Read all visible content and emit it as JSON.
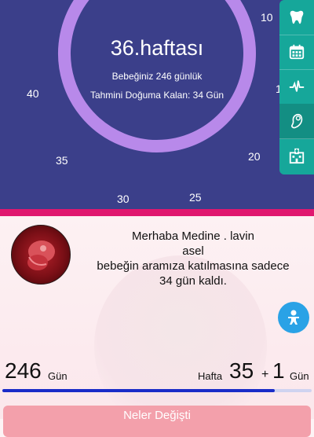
{
  "header": {
    "week_title": "36.haftası",
    "baby_age_text": "Bebeğiniz 246 günlük",
    "due_remaining_text": "Tahmini Doğuma Kalan: 34 Gün",
    "ticks": [
      "10",
      "1",
      "20",
      "25",
      "30",
      "35",
      "40"
    ],
    "ring_progress_fraction": 0.9,
    "colors": {
      "background": "#3b3f8a",
      "ring": "#b889ea",
      "ring_track": "#4d5199"
    }
  },
  "side_rail": {
    "items": [
      {
        "icon": "tooth-icon"
      },
      {
        "icon": "calendar-icon"
      },
      {
        "icon": "heartbeat-icon"
      },
      {
        "icon": "fetus-icon",
        "active": true
      },
      {
        "icon": "hospital-icon"
      }
    ],
    "color": "#16a79a"
  },
  "greeting": {
    "line1": "Merhaba Medine . lavin",
    "line2": "asel",
    "line3": "bebeğin aramıza katılmasına sadece",
    "line4": "34 gün kaldı."
  },
  "stats": {
    "days_value": "246",
    "days_unit": "Gün",
    "week_label": "Hafta",
    "week_value": "35",
    "plus_sign": "+",
    "extra_days_value": "1",
    "extra_days_unit": "Gün",
    "progress_fraction": 0.88
  },
  "cta": {
    "label": "Neler Değişti"
  },
  "accent_pink": "#e0176f"
}
